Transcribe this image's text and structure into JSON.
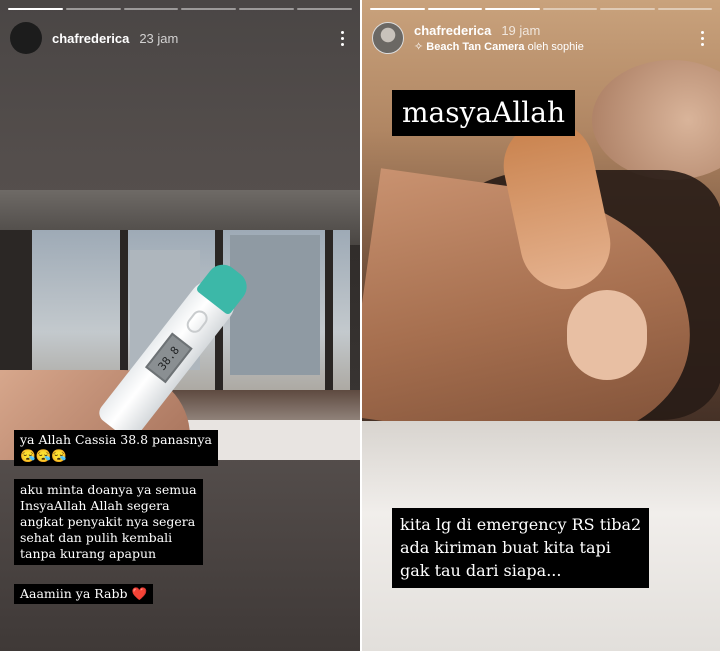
{
  "left_story": {
    "progress": {
      "total": 6,
      "completed": 1
    },
    "username": "chafrederica",
    "time": "23 jam",
    "thermometer_reading": "38.8",
    "caption_1_line1": "ya Allah Cassia 38.8 panasnya",
    "caption_1_line2": "😪😪😪",
    "caption_2_lines": [
      "aku minta doanya ya semua",
      "InsyaAllah Allah segera",
      "angkat penyakit nya segera",
      "sehat dan pulih kembali",
      "tanpa kurang apapun"
    ],
    "caption_3": "Aaamiin ya Rabb",
    "caption_3_heart": "❤️"
  },
  "right_story": {
    "progress": {
      "total": 6,
      "completed": 3
    },
    "username": "chafrederica",
    "time": "19 jam",
    "music_song": "Beach Tan Camera",
    "music_artist_prefix": "oleh sophie",
    "title_text": "masyaAllah",
    "caption_lines": [
      "kita lg di emergency RS tiba2",
      "ada kiriman buat kita tapi",
      "gak tau dari siapa..."
    ]
  },
  "icons": {
    "more": "more-vertical-icon",
    "music": "sparkle-music-icon"
  },
  "colors": {
    "text_box_bg": "#000000",
    "thermometer_cap": "#3cb8a8",
    "heart": "#e0332f"
  }
}
